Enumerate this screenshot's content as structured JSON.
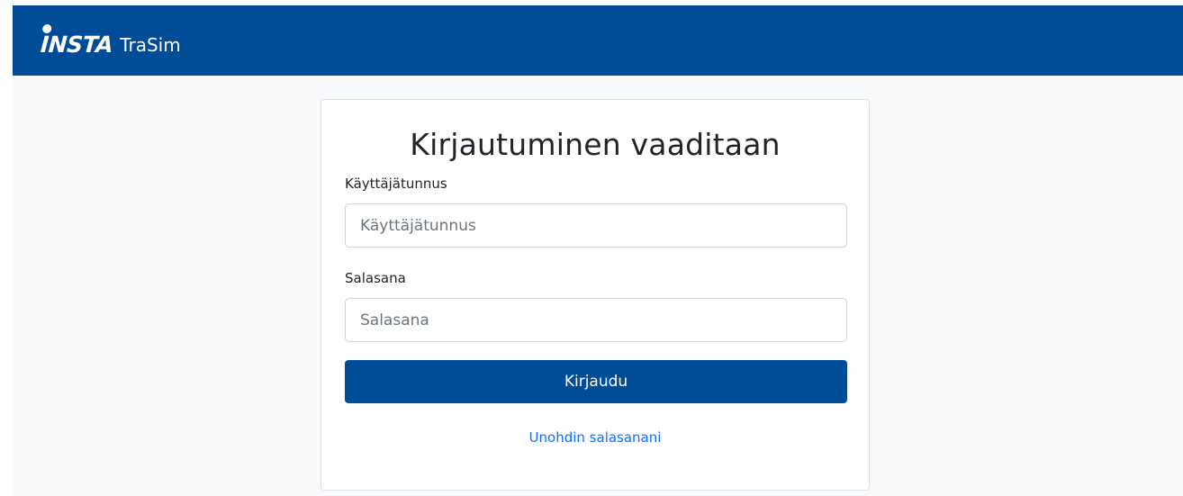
{
  "header": {
    "logo_mark": "INSTA",
    "product_name": "TraSim",
    "background_color": "#004c97"
  },
  "login": {
    "title": "Kirjautuminen vaaditaan",
    "username_label": "Käyttäjätunnus",
    "username_placeholder": "Käyttäjätunnus",
    "username_value": "",
    "password_label": "Salasana",
    "password_placeholder": "Salasana",
    "password_value": "",
    "submit_label": "Kirjaudu",
    "forgot_link": "Unohdin salasanani",
    "accent_color": "#004c97",
    "link_color": "#0d6efd"
  }
}
